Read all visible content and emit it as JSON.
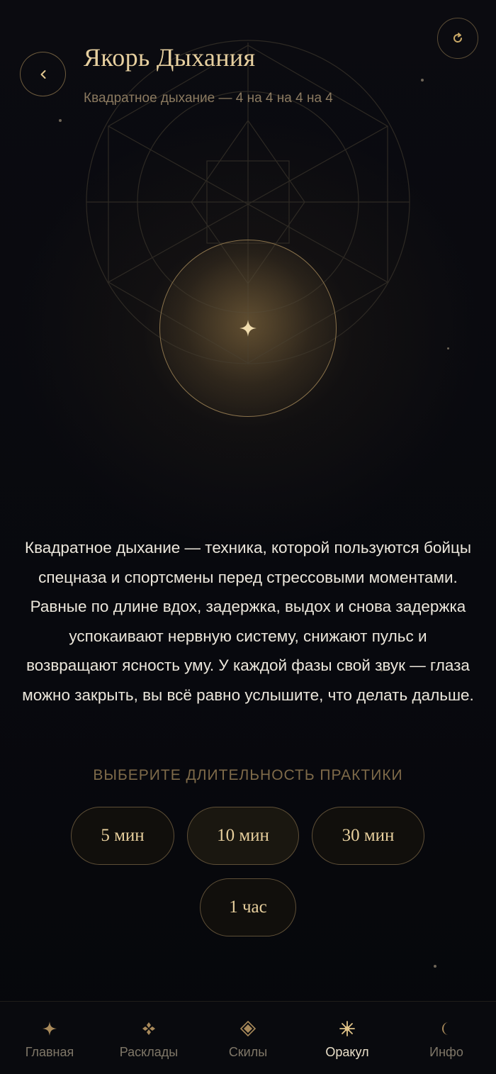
{
  "header": {
    "title": "Якорь Дыхания",
    "subtitle": "Квадратное дыхание — 4 на 4 на 4 на 4",
    "back_icon": "chevron-left-icon",
    "restart_icon": "refresh-icon"
  },
  "orb": {
    "icon": "sparkle-icon"
  },
  "description": "Квадратное дыхание — техника, которой пользуются бойцы спецназа и спортсмены перед стрессовыми моментами. Равные по длине вдох, задержка, выдох и снова задержка успокаивают нервную систему, снижают пульс и возвращают ясность уму. У каждой фазы свой звук — глаза можно закрыть, вы всё равно услышите, что делать дальше.",
  "duration": {
    "label": "ВЫБЕРИТЕ ДЛИТЕЛЬНОСТЬ ПРАКТИКИ",
    "options": [
      {
        "label": "5 мин"
      },
      {
        "label": "10 мин"
      },
      {
        "label": "30 мин"
      },
      {
        "label": "1 час"
      }
    ]
  },
  "nav": {
    "active": "Оракул",
    "items": [
      {
        "label": "Главная",
        "icon": "star-icon"
      },
      {
        "label": "Расклады",
        "icon": "clover-icon"
      },
      {
        "label": "Скилы",
        "icon": "diamond-icon"
      },
      {
        "label": "Оракул",
        "icon": "asterisk-icon"
      },
      {
        "label": "Инфо",
        "icon": "moon-icon"
      }
    ]
  },
  "colors": {
    "background": "#07080d",
    "gold": "#e6cf9f",
    "gold_dim": "#7e6a49",
    "border": "#5e4f37"
  }
}
